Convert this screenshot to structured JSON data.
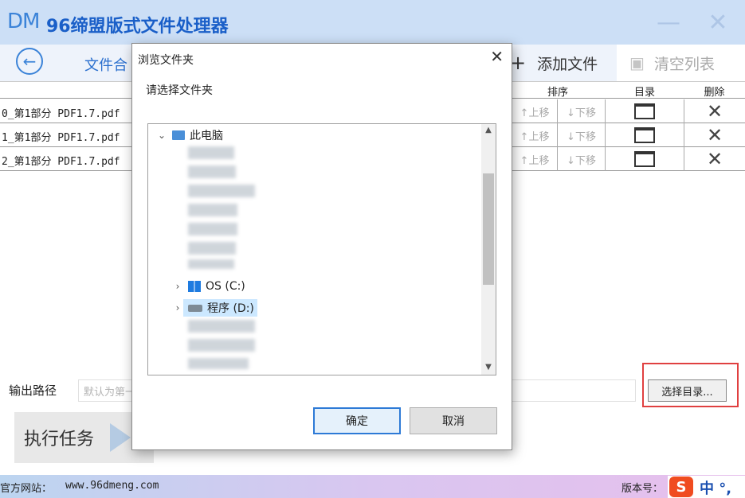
{
  "app": {
    "logo": "DM",
    "title": "96缔盟版式文件处理器",
    "minimize_glyph": "—",
    "close_glyph": "✕"
  },
  "toolbar": {
    "back_glyph": "←",
    "tab_label": "文件合",
    "add_label": "添加文件",
    "clear_label": "清空列表"
  },
  "table": {
    "headers": {
      "sort": "排序",
      "dir": "目录",
      "delete": "删除"
    },
    "move_up": "↑上移",
    "move_down": "↓下移",
    "rows": [
      {
        "name": "0_第1部分 PDF1.7.pdf"
      },
      {
        "name": "1_第1部分 PDF1.7.pdf"
      },
      {
        "name": "2_第1部分 PDF1.7.pdf"
      }
    ]
  },
  "bottom": {
    "output_label": "输出路径",
    "output_placeholder": "默认为第一",
    "select_dir_label": "选择目录...",
    "run_label": "执行任务"
  },
  "status": {
    "site_label": "官方网站：",
    "site_url": "www.96dmeng.com",
    "version_label": "版本号：",
    "ime_text": "中 °,"
  },
  "dialog": {
    "title": "浏览文件夹",
    "close_glyph": "✕",
    "prompt": "请选择文件夹",
    "tree": {
      "root": "此电脑",
      "drive_c": "OS (C:)",
      "drive_d": "程序 (D:)"
    },
    "ok_label": "确定",
    "cancel_label": "取消"
  },
  "colors": {
    "title_bar": "#ccdff6",
    "accent_blue": "#2d7ad6",
    "highlight_red": "#e04040",
    "selected_row": "#cce8ff"
  }
}
